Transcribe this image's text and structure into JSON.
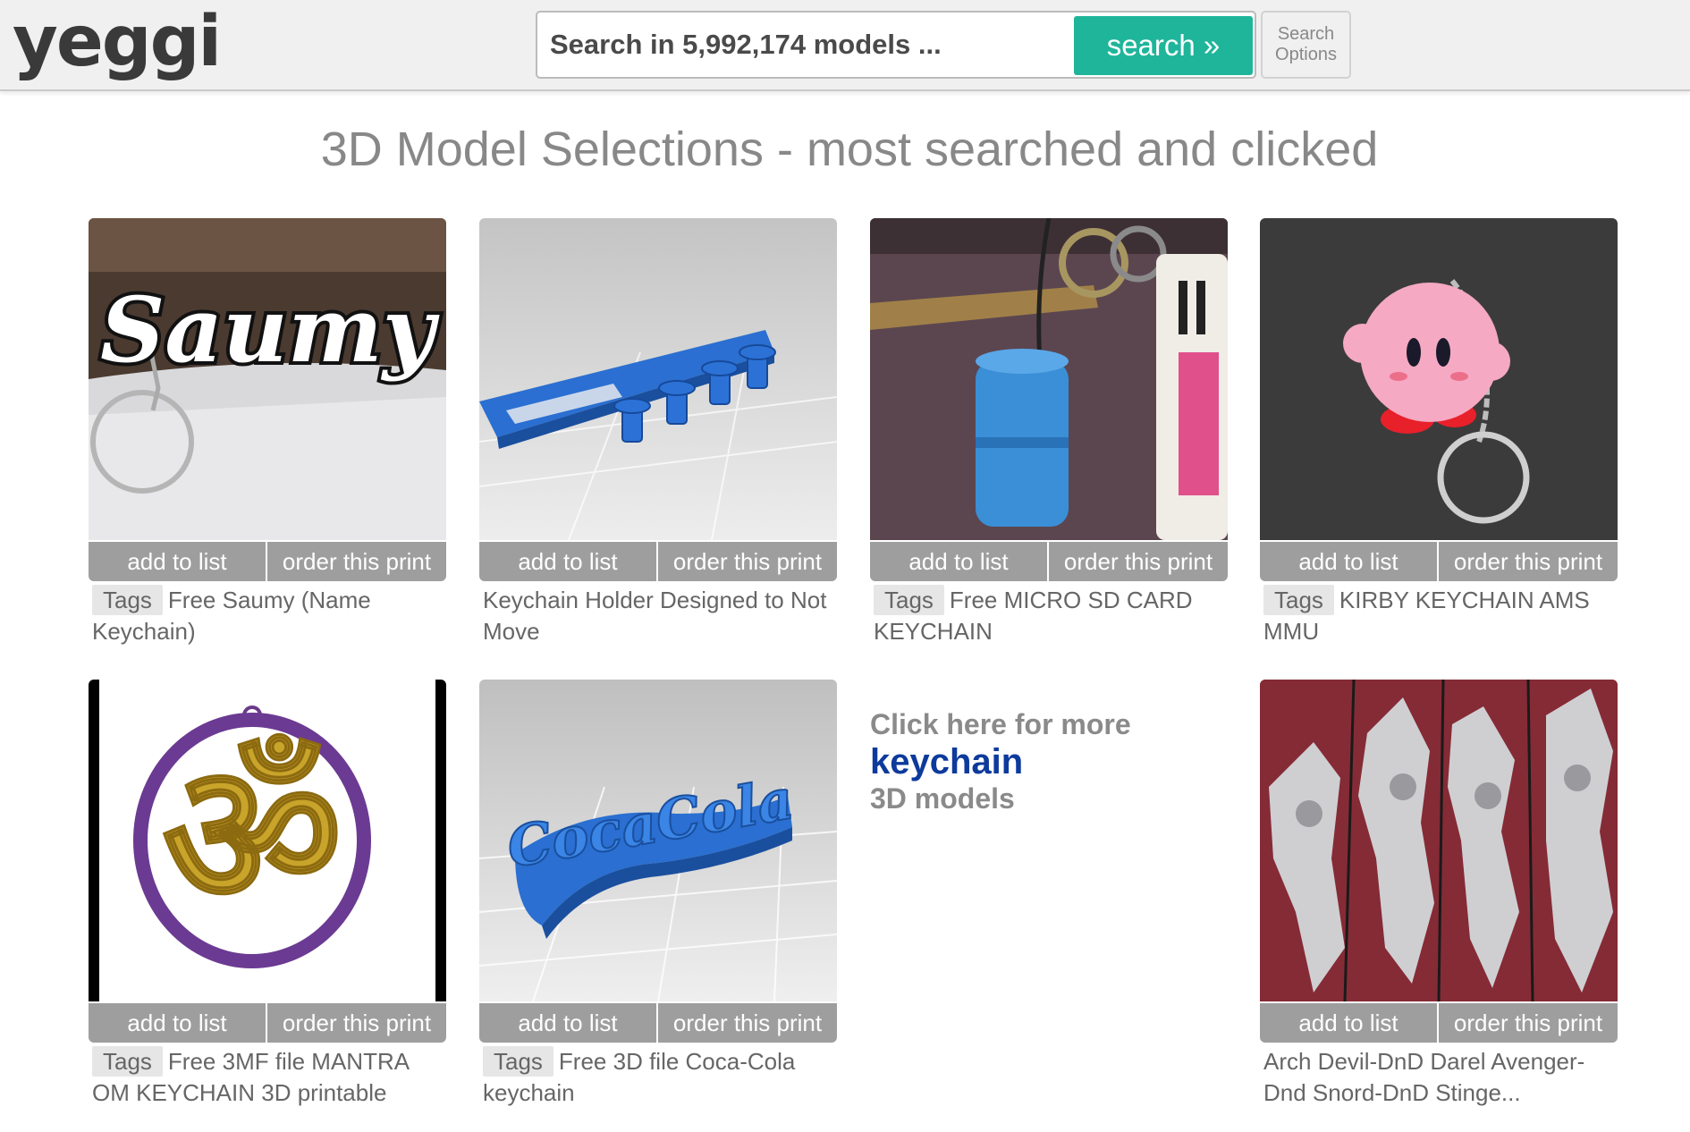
{
  "header": {
    "logo": "yeggi",
    "search_placeholder": "Search in 5,992,174 models ...",
    "search_button": "search »",
    "options_line1": "Search",
    "options_line2": "Options"
  },
  "page_title": "3D Model Selections - most searched and clicked",
  "actions": {
    "add": "add to list",
    "order": "order this print"
  },
  "tag_label": "Tags",
  "cards": [
    {
      "title": "Free Saumy (Name Keychain)",
      "has_tags": true
    },
    {
      "title": "Keychain Holder Designed to Not Move",
      "has_tags": false
    },
    {
      "title": "Free MICRO SD CARD KEYCHAIN",
      "has_tags": true
    },
    {
      "title": "KIRBY KEYCHAIN AMS MMU",
      "has_tags": true
    },
    {
      "title": "Free 3MF file MANTRA OM KEYCHAIN 3D printable",
      "has_tags": true
    },
    {
      "title": "Free 3D file Coca-Cola keychain",
      "has_tags": true
    },
    {
      "title": "Arch Devil-DnD Darel Avenger-Dnd Snord-DnD Stinge...",
      "has_tags": false
    }
  ],
  "more_link": {
    "line1": "Click here for more",
    "keyword": "keychain",
    "line3": "3D models"
  },
  "images": {
    "saumy_text": "Saumy",
    "coca_text": "CocaCola"
  },
  "colors": {
    "accent": "#1fb59a",
    "button_gray": "#9e9e9e",
    "keyword_blue": "#0d3a9c"
  }
}
